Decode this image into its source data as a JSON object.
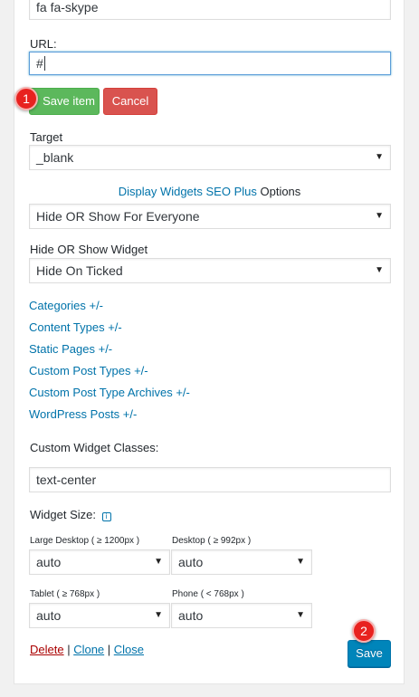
{
  "icon_class_field": {
    "value": "fa fa-skype"
  },
  "url_field": {
    "label": "URL:",
    "value": "#"
  },
  "item_actions": {
    "save_label": "Save item",
    "cancel_label": "Cancel"
  },
  "target": {
    "label": "Target",
    "selected": "_blank"
  },
  "dw_options": {
    "link_text": "Display Widgets SEO Plus",
    "suffix_text": " Options",
    "selected": "Hide OR Show For Everyone"
  },
  "hide_show": {
    "label": "Hide OR Show Widget",
    "selected": "Hide On Ticked"
  },
  "toggle_links": [
    "Categories +/-",
    "Content Types +/-",
    "Static Pages +/-",
    "Custom Post Types +/-",
    "Custom Post Type Archives +/-",
    "WordPress Posts +/-"
  ],
  "custom_classes": {
    "label": "Custom Widget Classes:",
    "value": "text-center"
  },
  "widget_size": {
    "label": "Widget Size:",
    "info_icon": "info-icon",
    "large_desktop": {
      "label": "Large Desktop ( ≥ 1200px )",
      "selected": "auto"
    },
    "desktop": {
      "label": "Desktop ( ≥ 992px )",
      "selected": "auto"
    },
    "tablet": {
      "label": "Tablet ( ≥ 768px )",
      "selected": "auto"
    },
    "phone": {
      "label": "Phone ( < 768px )",
      "selected": "auto"
    }
  },
  "footer_actions": {
    "delete": "Delete",
    "clone": "Clone",
    "close": "Close",
    "separator": " | ",
    "save": "Save"
  },
  "markers": {
    "first": "1",
    "second": "2"
  },
  "select_arrow": "▼",
  "colors": {
    "link": "#0073aa",
    "save_item_green": "#5cb85c",
    "cancel_red": "#d9534f",
    "save_blue": "#0085ba",
    "delete_red": "#a00",
    "marker_red": "#e8221f"
  }
}
